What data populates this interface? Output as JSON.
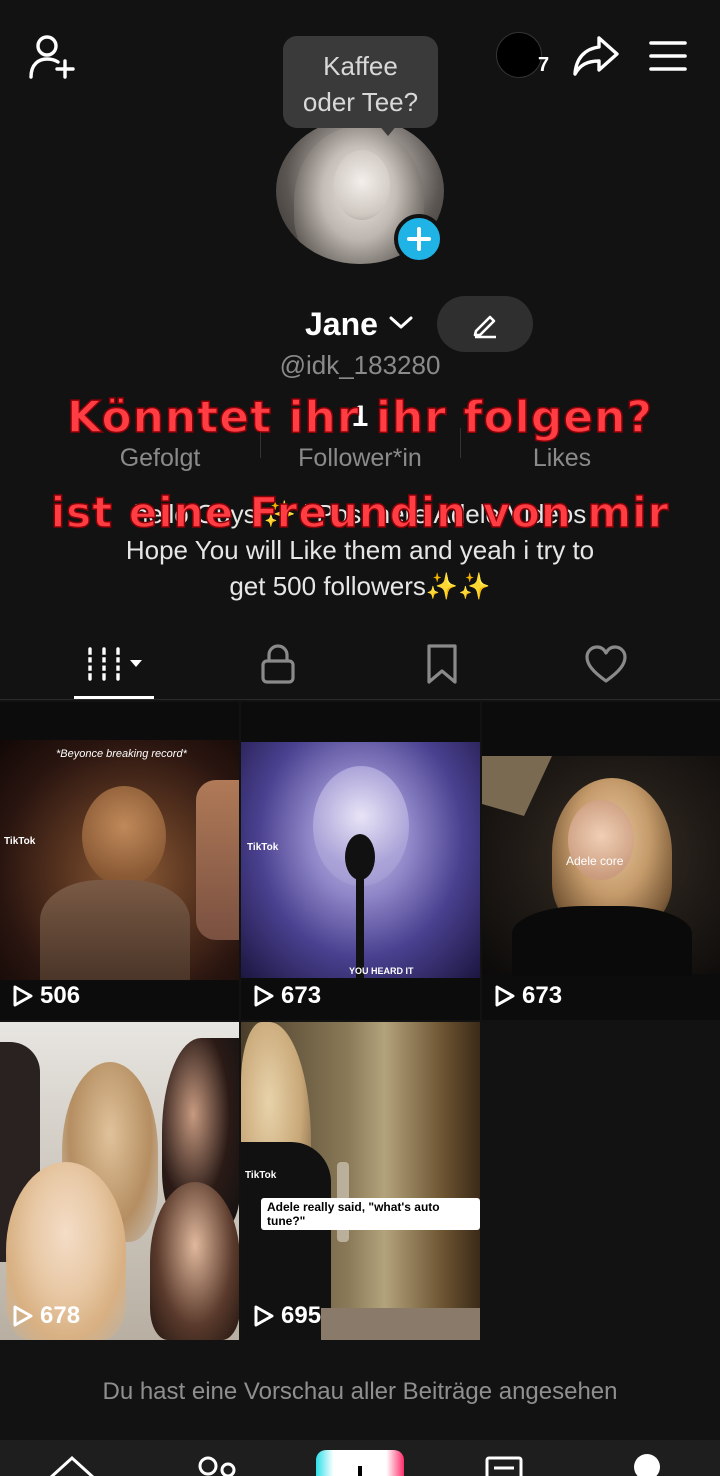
{
  "bubble": {
    "line1": "Kaffee",
    "line2": "oder Tee?"
  },
  "notifications": {
    "count": "7"
  },
  "profile": {
    "name": "Jane",
    "handle": "@idk_183280"
  },
  "stats": [
    {
      "value": "",
      "label": "Gefolgt"
    },
    {
      "value": "1",
      "label": "Follower*in"
    },
    {
      "value": "",
      "label": "Likes"
    }
  ],
  "bio": {
    "line1": "hello Guys ✨‍ i Post here Adele Videos",
    "line2": "Hope You will Like them and yeah i try to",
    "line3": "get 500 followers✨✨"
  },
  "overlay_text": {
    "line1": "Könntet ihr ihr folgen?",
    "line2": "ist eine Freundin von mir"
  },
  "videos": [
    {
      "views": "506",
      "caption": "*Beyonce breaking record*",
      "watermark": "TikTok"
    },
    {
      "views": "673",
      "caption": "YOU HEARD IT",
      "watermark": "TikTok"
    },
    {
      "views": "673",
      "caption": "Adele core",
      "watermark": ""
    },
    {
      "views": "678",
      "caption": "",
      "watermark": ""
    },
    {
      "views": "695",
      "caption": "Adele really said, \"what's auto tune?\"",
      "watermark": "TikTok"
    }
  ],
  "footer": {
    "message": "Du hast eine Vorschau aller Beiträge angesehen"
  },
  "colors": {
    "accent": "#1fb3e6",
    "overlay": "#ff3d43",
    "background": "#121212"
  }
}
